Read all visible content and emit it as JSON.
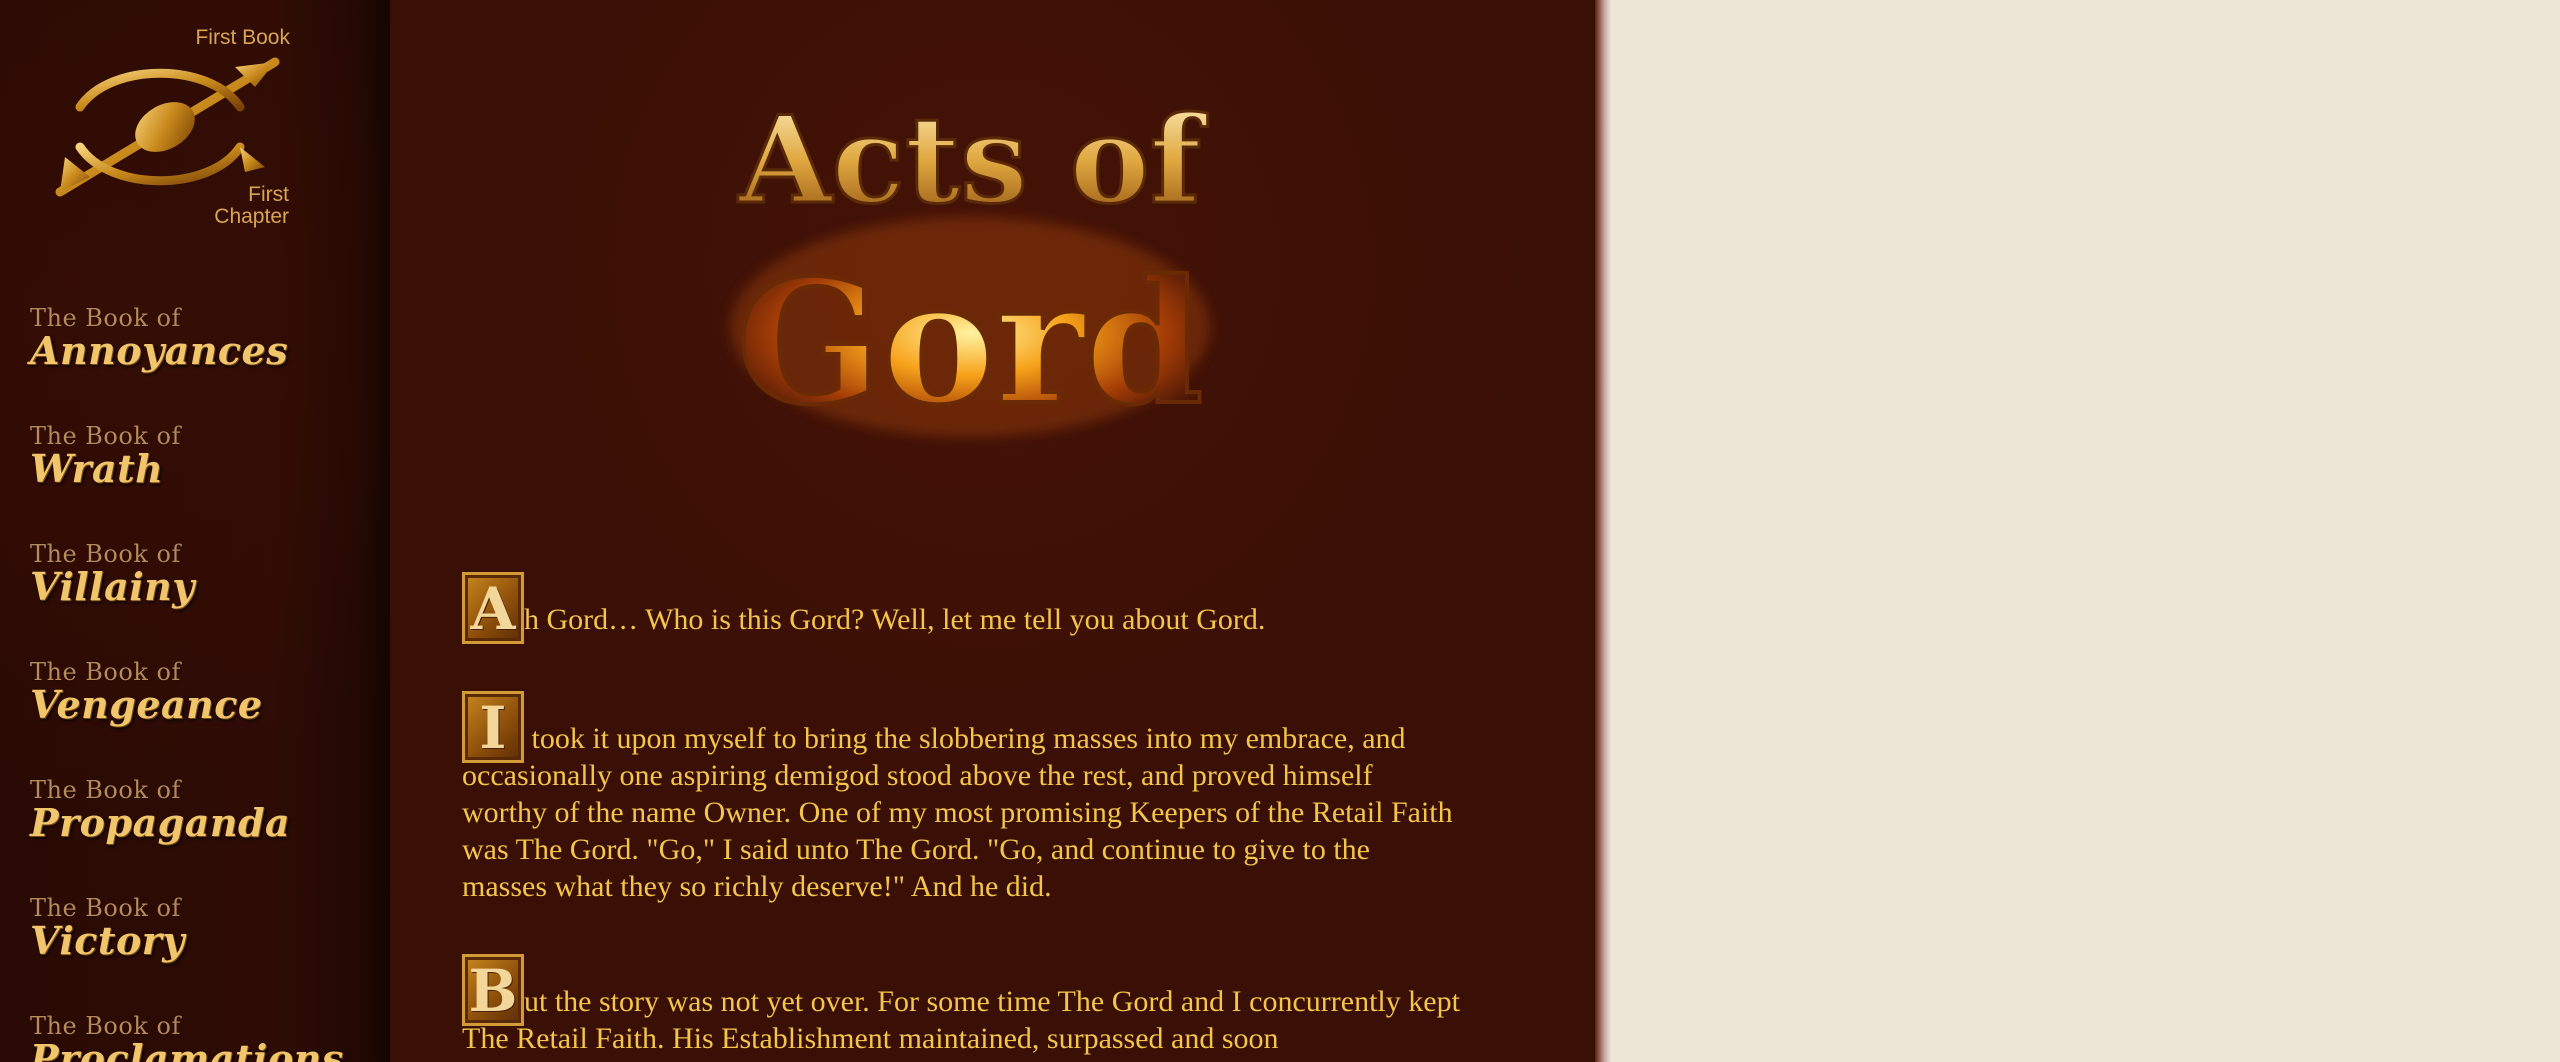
{
  "nav": {
    "first_book": "First Book",
    "first_chapter_line1": "First",
    "first_chapter_line2": "Chapter"
  },
  "logo": {
    "icon": "golden-arrow-emblem-icon"
  },
  "books": [
    {
      "prefix": "The Book of",
      "name": "Annoyances"
    },
    {
      "prefix": "The Book of",
      "name": "Wrath"
    },
    {
      "prefix": "The Book of",
      "name": "Villainy"
    },
    {
      "prefix": "The Book of",
      "name": "Vengeance"
    },
    {
      "prefix": "The Book of",
      "name": "Propaganda"
    },
    {
      "prefix": "The Book of",
      "name": "Victory"
    },
    {
      "prefix": "The Book of",
      "name": "Proclamations"
    }
  ],
  "title": {
    "line1": "Acts of",
    "line2": "Gord"
  },
  "paragraphs": [
    {
      "cap": "A",
      "text": "h Gord… Who is this Gord? Well, let me tell you about Gord."
    },
    {
      "cap": "I",
      "text": " took it upon myself to bring the slobbering masses into my embrace, and occasionally one aspiring demigod stood above the rest, and proved himself worthy of the name Owner. One of my most promising Keepers of the Retail Faith was The Gord. \"Go,\" I said unto The Gord. \"Go, and continue to give to the masses what they so richly deserve!\" And he did."
    },
    {
      "cap": "B",
      "text": "ut the story was not yet over. For some time The Gord and I concurrently kept The Retail Faith. His Establishment maintained, surpassed and soon"
    }
  ],
  "colors": {
    "text": "#f3c54a",
    "background": "#3a0f06",
    "page": "#ede5d5",
    "gold": "#d9a552"
  }
}
